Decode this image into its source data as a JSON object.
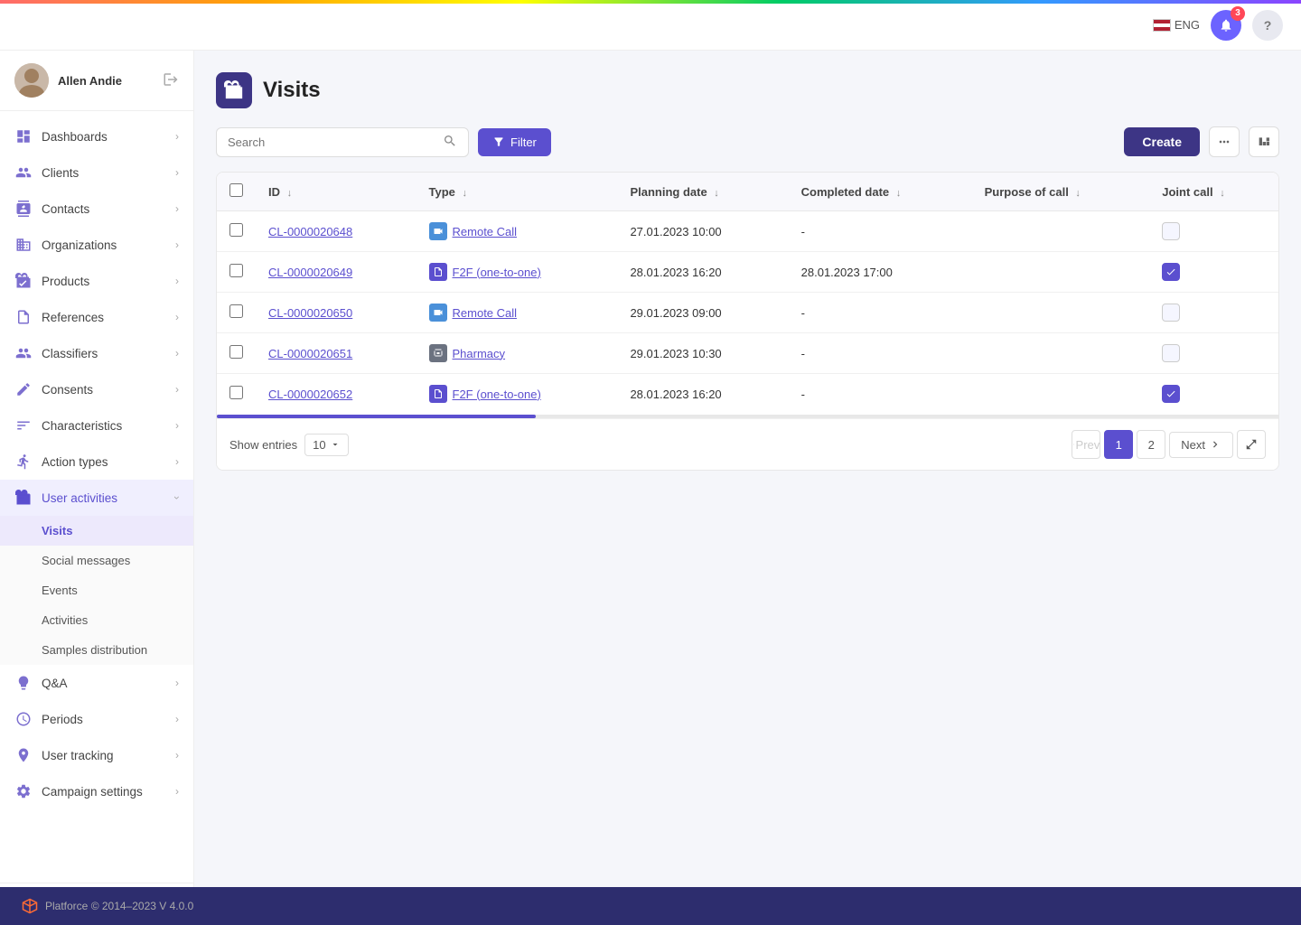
{
  "topbar": {
    "lang": "ENG",
    "bell_count": "3",
    "help_label": "?"
  },
  "sidebar": {
    "user": {
      "name": "Allen Andie",
      "logout_icon": "→"
    },
    "nav_items": [
      {
        "id": "dashboards",
        "label": "Dashboards",
        "icon": "dashboard",
        "has_children": true
      },
      {
        "id": "clients",
        "label": "Clients",
        "icon": "clients",
        "has_children": true
      },
      {
        "id": "contacts",
        "label": "Contacts",
        "icon": "contacts",
        "has_children": true
      },
      {
        "id": "organizations",
        "label": "Organizations",
        "icon": "organizations",
        "has_children": true
      },
      {
        "id": "products",
        "label": "Products",
        "icon": "products",
        "has_children": true
      },
      {
        "id": "references",
        "label": "References",
        "icon": "references",
        "has_children": true
      },
      {
        "id": "classifiers",
        "label": "Classifiers",
        "icon": "classifiers",
        "has_children": true
      },
      {
        "id": "consents",
        "label": "Consents",
        "icon": "consents",
        "has_children": true
      },
      {
        "id": "characteristics",
        "label": "Characteristics",
        "icon": "characteristics",
        "has_children": true
      },
      {
        "id": "action-types",
        "label": "Action types",
        "icon": "action-types",
        "has_children": true
      },
      {
        "id": "user-activities",
        "label": "User activities",
        "icon": "user-activities",
        "has_children": true,
        "open": true
      }
    ],
    "sub_items": [
      {
        "id": "visits",
        "label": "Visits",
        "active": true
      },
      {
        "id": "social-messages",
        "label": "Social messages"
      },
      {
        "id": "events",
        "label": "Events"
      },
      {
        "id": "activities",
        "label": "Activities"
      },
      {
        "id": "samples-distribution",
        "label": "Samples distribution"
      }
    ],
    "bottom_items": [
      {
        "id": "qa",
        "label": "Q&A",
        "icon": "qa",
        "has_children": true
      },
      {
        "id": "periods",
        "label": "Periods",
        "icon": "periods",
        "has_children": true
      },
      {
        "id": "user-tracking",
        "label": "User tracking",
        "icon": "user-tracking",
        "has_children": true
      },
      {
        "id": "campaign-settings",
        "label": "Campaign settings",
        "icon": "campaign-settings",
        "has_children": true
      }
    ],
    "footer": {
      "logo_text": "platforce"
    }
  },
  "page": {
    "title": "Visits",
    "icon": "briefcase"
  },
  "toolbar": {
    "search_placeholder": "Search",
    "filter_label": "Filter",
    "create_label": "Create"
  },
  "table": {
    "columns": [
      {
        "id": "id",
        "label": "ID"
      },
      {
        "id": "type",
        "label": "Type"
      },
      {
        "id": "planning_date",
        "label": "Planning date"
      },
      {
        "id": "completed_date",
        "label": "Completed date"
      },
      {
        "id": "purpose_of_call",
        "label": "Purpose of call"
      },
      {
        "id": "joint_call",
        "label": "Joint call"
      }
    ],
    "rows": [
      {
        "id": "CL-0000020648",
        "type_label": "Remote Call",
        "type_icon": "video",
        "planning_date": "27.01.2023 10:00",
        "completed_date": "-",
        "purpose_of_call": "",
        "joint_call": false
      },
      {
        "id": "CL-0000020649",
        "type_label": "F2F (one-to-one)",
        "type_icon": "f2f",
        "planning_date": "28.01.2023 16:20",
        "completed_date": "28.01.2023 17:00",
        "purpose_of_call": "",
        "joint_call": true
      },
      {
        "id": "CL-0000020650",
        "type_label": "Remote Call",
        "type_icon": "video",
        "planning_date": "29.01.2023 09:00",
        "completed_date": "-",
        "purpose_of_call": "",
        "joint_call": false
      },
      {
        "id": "CL-0000020651",
        "type_label": "Pharmacy",
        "type_icon": "pharmacy",
        "planning_date": "29.01.2023 10:30",
        "completed_date": "-",
        "purpose_of_call": "",
        "joint_call": false
      },
      {
        "id": "CL-0000020652",
        "type_label": "F2F (one-to-one)",
        "type_icon": "f2f",
        "planning_date": "28.01.2023 16:20",
        "completed_date": "-",
        "purpose_of_call": "",
        "joint_call": true
      }
    ]
  },
  "pagination": {
    "show_entries_label": "Show entries",
    "entries_count": "10",
    "prev_label": "Prev",
    "next_label": "Next",
    "current_page": 1,
    "total_pages": 2
  },
  "footer": {
    "text": "Platforce © 2014–2023 V 4.0.0"
  }
}
